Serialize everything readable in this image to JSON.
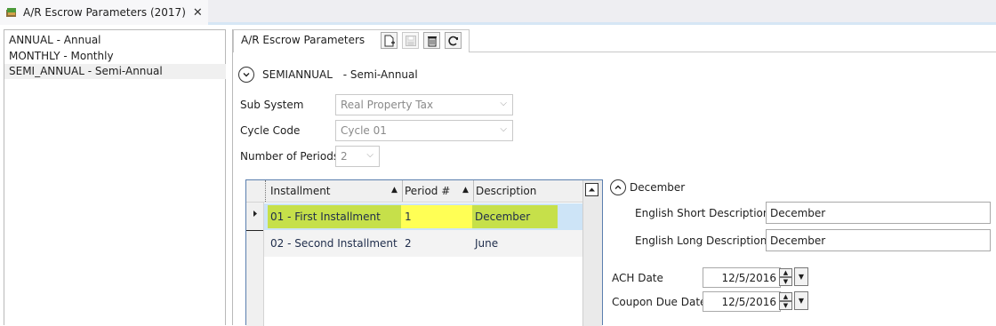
{
  "document_tab": {
    "title": "A/R Escrow Parameters (2017)",
    "close_glyph": "✕"
  },
  "list": {
    "items": [
      {
        "label": "ANNUAL - Annual"
      },
      {
        "label": "MONTHLY - Monthly"
      },
      {
        "label": "SEMI_ANNUAL - Semi-Annual",
        "selected": true
      }
    ]
  },
  "panel": {
    "tab_label": "A/R Escrow Parameters",
    "toolbar": {
      "new_icon": "new-document-icon",
      "save_icon": "save-icon",
      "delete_icon": "delete-icon",
      "refresh_icon": "refresh-icon"
    },
    "header": {
      "code": "SEMIANNUAL",
      "description": "- Semi-Annual"
    },
    "fields": {
      "sub_system": {
        "label": "Sub System",
        "value": "Real Property Tax"
      },
      "cycle_code": {
        "label": "Cycle Code",
        "value": "Cycle 01"
      },
      "num_periods": {
        "label": "Number of Periods",
        "value": "2"
      }
    },
    "grid": {
      "columns": [
        "Installment",
        "Period #",
        "Description"
      ],
      "rows": [
        {
          "installment": "01 - First Installment",
          "period": "1",
          "description": "December",
          "selected": true
        },
        {
          "installment": "02 - Second Installment",
          "period": "2",
          "description": "June"
        }
      ]
    },
    "detail": {
      "header": "December",
      "short_desc_label": "English Short Description",
      "short_desc_value": "December",
      "long_desc_label": "English Long Description",
      "long_desc_value": "December",
      "ach_date_label": "ACH Date",
      "ach_date_value": "12/5/2016",
      "coupon_due_label": "Coupon Due Date",
      "coupon_due_value": "12/5/2016"
    }
  },
  "colors": {
    "highlight_green": "#c6e04a",
    "highlight_yellow": "#ffff55",
    "selection_blue": "#cde4f7",
    "grid_border": "#5b7fae"
  }
}
